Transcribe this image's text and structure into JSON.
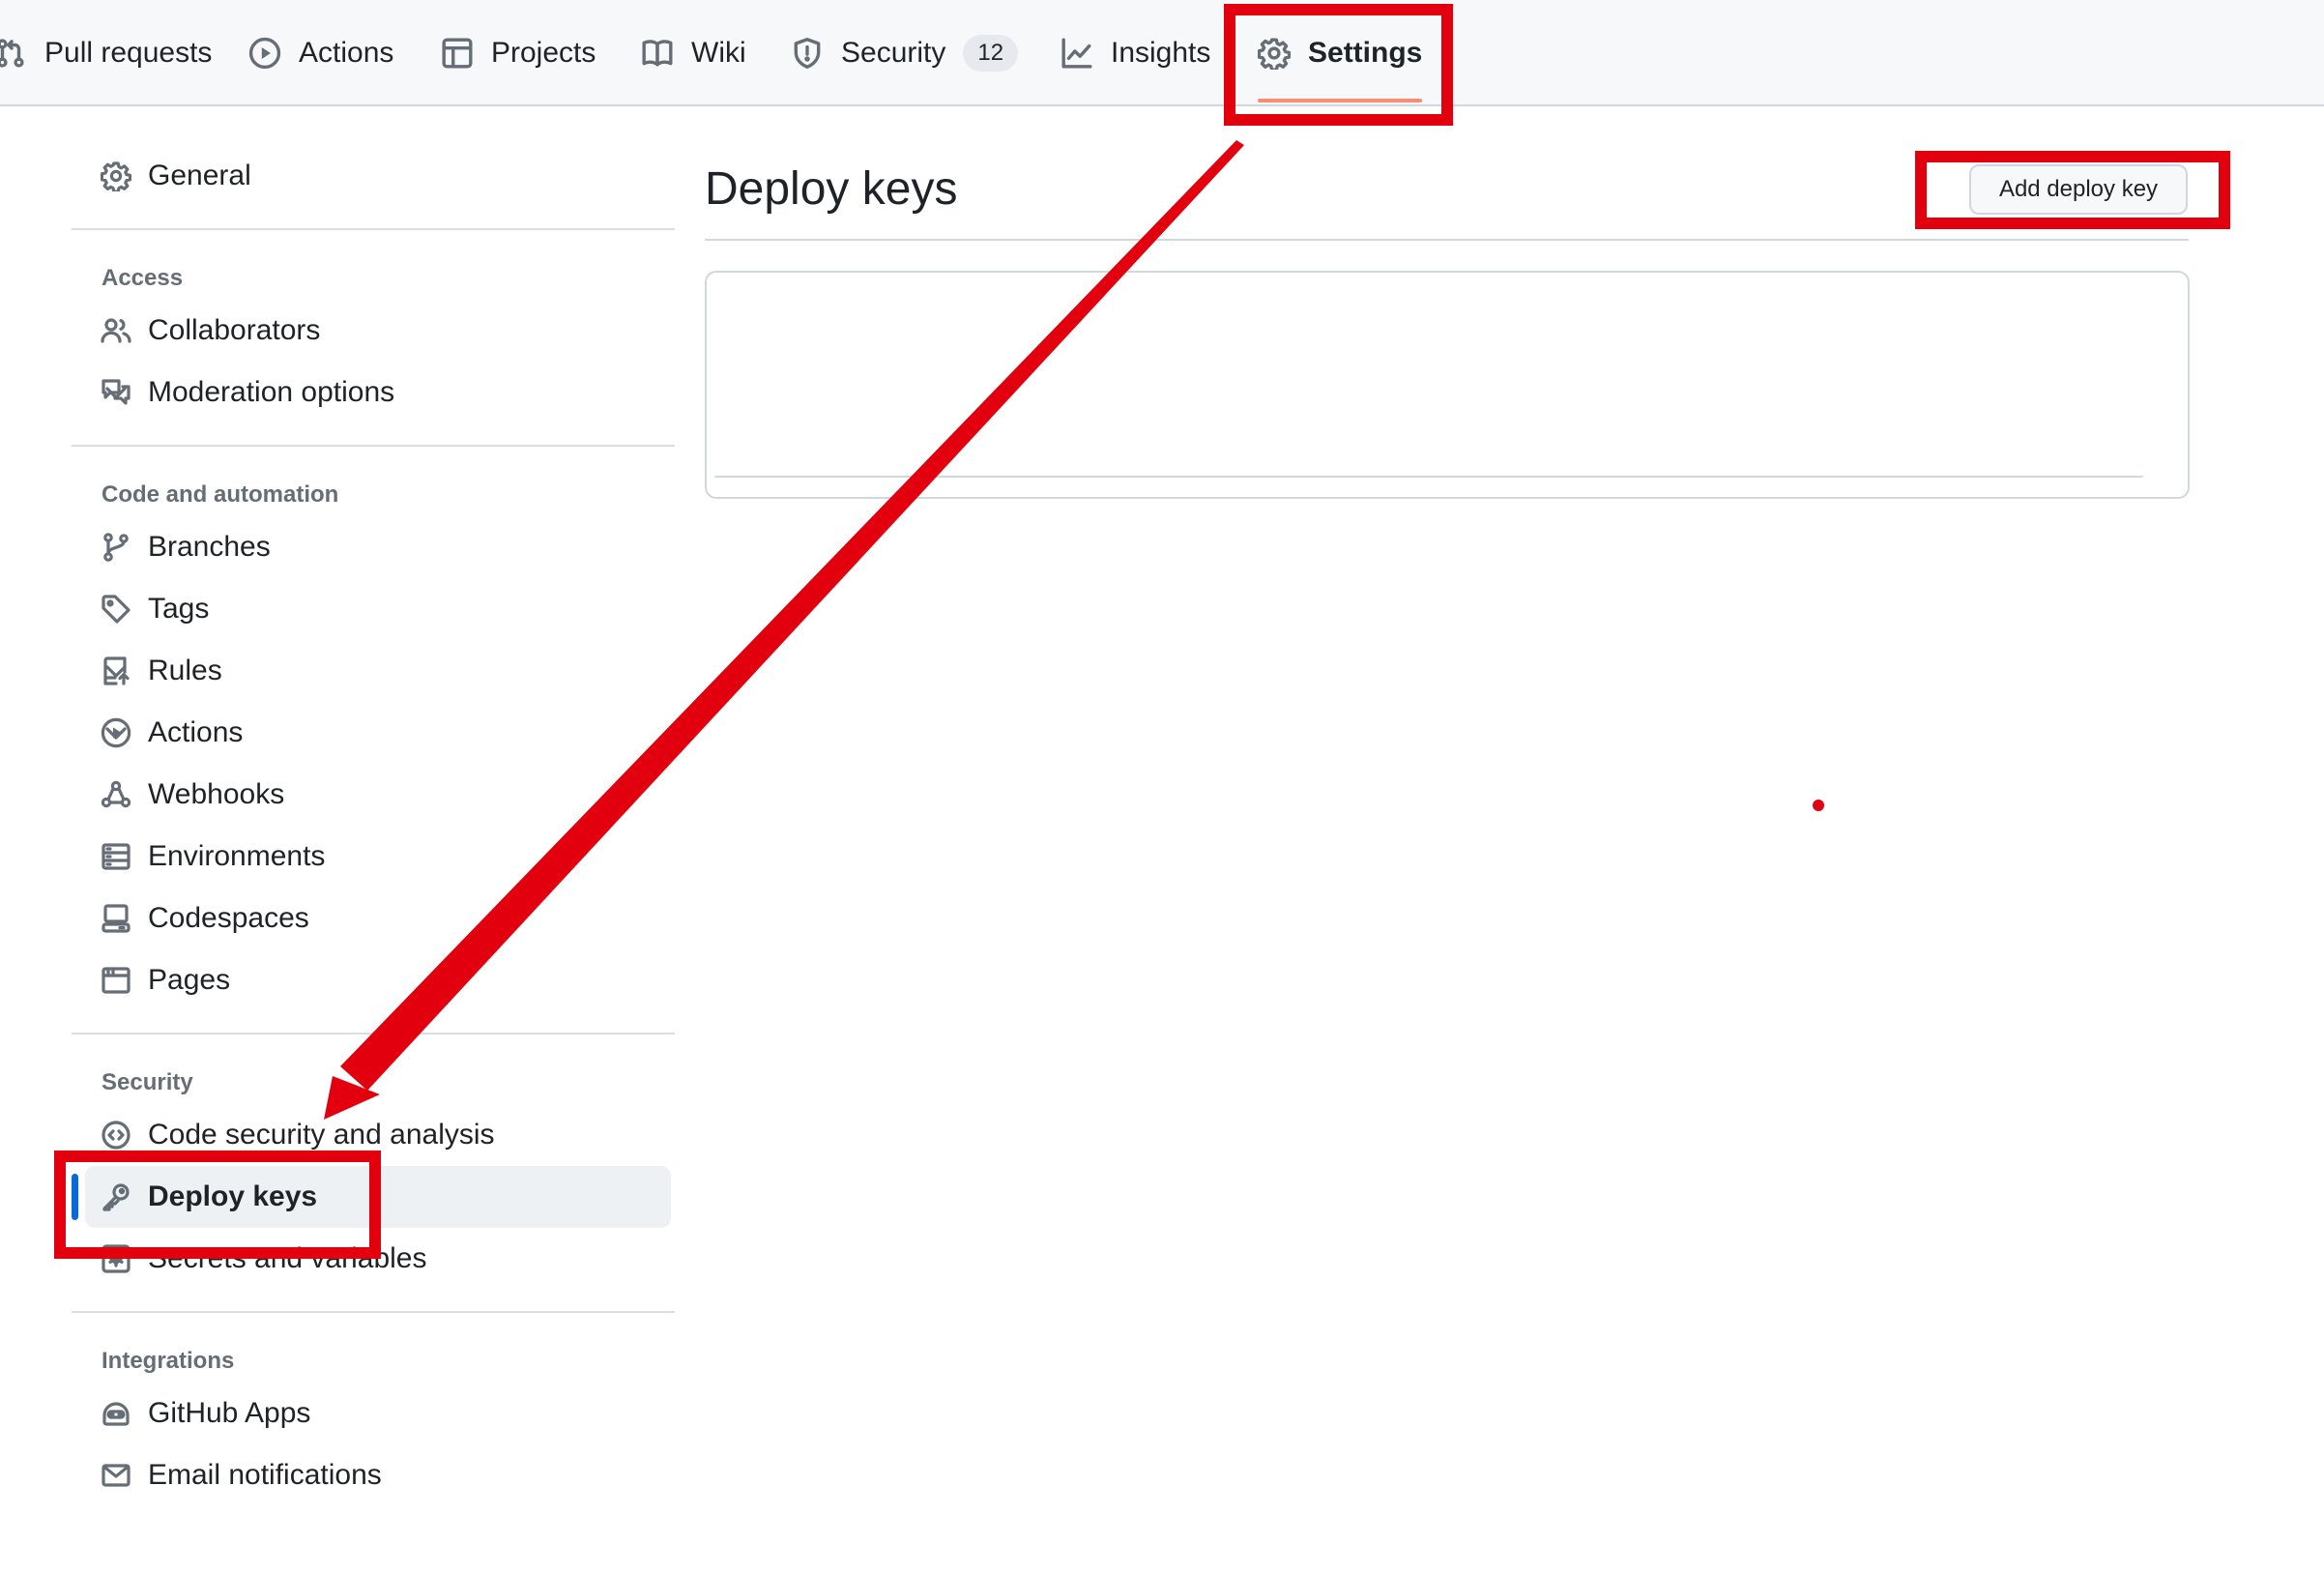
{
  "nav": {
    "tabs": [
      {
        "label": "Pull requests",
        "icon": "git-pull-request-icon"
      },
      {
        "label": "Actions",
        "icon": "play-icon"
      },
      {
        "label": "Projects",
        "icon": "table-icon"
      },
      {
        "label": "Wiki",
        "icon": "book-icon"
      },
      {
        "label": "Security",
        "icon": "shield-icon",
        "counter": "12"
      },
      {
        "label": "Insights",
        "icon": "graph-icon"
      },
      {
        "label": "Settings",
        "icon": "gear-icon",
        "selected": true
      }
    ]
  },
  "sidebar": {
    "general": {
      "label": "General",
      "icon": "gear-icon"
    },
    "sections": [
      {
        "heading": "Access",
        "items": [
          {
            "label": "Collaborators",
            "icon": "people-icon"
          },
          {
            "label": "Moderation options",
            "icon": "comment-discussion-icon",
            "expandable": true
          }
        ]
      },
      {
        "heading": "Code and automation",
        "items": [
          {
            "label": "Branches",
            "icon": "git-branch-icon"
          },
          {
            "label": "Tags",
            "icon": "tag-icon"
          },
          {
            "label": "Rules",
            "icon": "repo-push-icon",
            "expandable": true
          },
          {
            "label": "Actions",
            "icon": "play-icon",
            "expandable": true
          },
          {
            "label": "Webhooks",
            "icon": "webhook-icon"
          },
          {
            "label": "Environments",
            "icon": "server-icon"
          },
          {
            "label": "Codespaces",
            "icon": "codespaces-icon"
          },
          {
            "label": "Pages",
            "icon": "browser-icon"
          }
        ]
      },
      {
        "heading": "Security",
        "items": [
          {
            "label": "Code security and analysis",
            "icon": "codescan-icon"
          },
          {
            "label": "Deploy keys",
            "icon": "key-icon",
            "active": true
          },
          {
            "label": "Secrets and variables",
            "icon": "key-asterisk-icon",
            "expandable": true
          }
        ]
      },
      {
        "heading": "Integrations",
        "items": [
          {
            "label": "GitHub Apps",
            "icon": "hubot-icon"
          },
          {
            "label": "Email notifications",
            "icon": "mail-icon"
          }
        ]
      }
    ]
  },
  "main": {
    "title": "Deploy keys",
    "add_button_label": "Add deploy key"
  },
  "annotations": {
    "color": "#e2000f",
    "highlights": [
      "settings-tab",
      "add-deploy-key-button",
      "deploy-keys-sidebar-item"
    ],
    "arrow": "from settings tab to deploy keys sidebar item"
  },
  "colors": {
    "accent": "#0969da",
    "selected_underline": "#fd8c73",
    "border": "#d0d7de",
    "muted_text": "#656d76"
  }
}
